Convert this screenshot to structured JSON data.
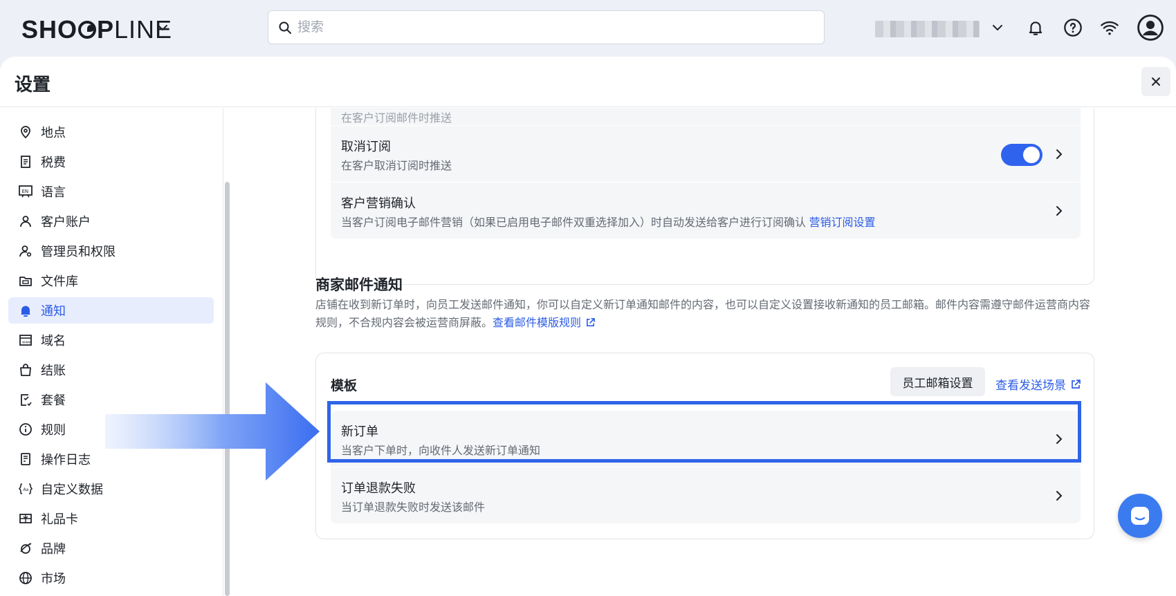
{
  "topbar": {
    "logo_bold": "SHO",
    "logo_rest_bold": "P",
    "logo_light": "LINE",
    "search_placeholder": "搜索"
  },
  "panel": {
    "title": "设置"
  },
  "sidebar": {
    "items": [
      {
        "label": "地点",
        "icon": "location-pin-icon"
      },
      {
        "label": "税费",
        "icon": "tax-receipt-icon"
      },
      {
        "label": "语言",
        "icon": "language-icon"
      },
      {
        "label": "客户账户",
        "icon": "user-icon"
      },
      {
        "label": "管理员和权限",
        "icon": "admin-user-icon"
      },
      {
        "label": "文件库",
        "icon": "folder-icon"
      },
      {
        "label": "通知",
        "icon": "bell-icon",
        "active": true
      },
      {
        "label": "域名",
        "icon": "domain-icon"
      },
      {
        "label": "结账",
        "icon": "shopping-bag-icon"
      },
      {
        "label": "套餐",
        "icon": "plan-icon"
      },
      {
        "label": "规则",
        "icon": "info-icon"
      },
      {
        "label": "操作日志",
        "icon": "log-icon"
      },
      {
        "label": "自定义数据",
        "icon": "custom-data-icon"
      },
      {
        "label": "礼品卡",
        "icon": "gift-card-icon"
      },
      {
        "label": "品牌",
        "icon": "brand-icon"
      },
      {
        "label": "市场",
        "icon": "globe-icon"
      }
    ]
  },
  "customer_card": {
    "partial_desc": "在客户订阅邮件时推送",
    "rows": [
      {
        "title": "取消订阅",
        "desc": "在客户取消订阅时推送",
        "toggle_on": true
      },
      {
        "title": "客户营销确认",
        "desc": "当客户订阅电子邮件营销（如果已启用电子邮件双重选择加入）时自动发送给客户进行订阅确认",
        "link": "营销订阅设置"
      }
    ]
  },
  "merchant_section": {
    "title": "商家邮件通知",
    "desc": "店铺在收到新订单时，向员工发送邮件通知，你可以自定义新订单通知邮件的内容，也可以自定义设置接收新通知的员工邮箱。邮件内容需遵守邮件运营商内容规则，不合规内容会被运营商屏蔽。",
    "link": "查看邮件模版规则"
  },
  "template_card": {
    "title": "模板",
    "staff_button": "员工邮箱设置",
    "view_link": "查看发送场景",
    "rows": [
      {
        "title": "新订单",
        "desc": "当客户下单时，向收件人发送新订单通知"
      },
      {
        "title": "订单退款失败",
        "desc": "当订单退款失败时发送该邮件"
      }
    ]
  },
  "colors": {
    "accent": "#2b5ce6",
    "highlight": "#2e64e8",
    "chat": "#3b7bf0"
  }
}
